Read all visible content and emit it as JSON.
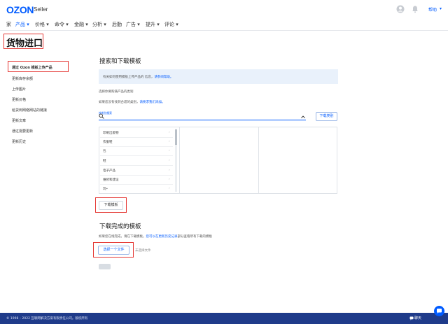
{
  "header": {
    "logo": "OZON",
    "logo_sub": "Seller",
    "help_label": "帮助",
    "help_caret": "▾"
  },
  "nav": {
    "items": [
      {
        "label": "家"
      },
      {
        "label": "产品 ▾"
      },
      {
        "label": "价格 ▾"
      },
      {
        "label": "命令 ▾"
      },
      {
        "label": "金融 ▾"
      },
      {
        "label": "分析 ▾"
      },
      {
        "label": "后勤"
      },
      {
        "label": "广告 ▾"
      },
      {
        "label": "提升 ▾"
      },
      {
        "label": "评论 ▾"
      }
    ]
  },
  "page_title": "货物进口",
  "sidebar": {
    "items": [
      {
        "label": "通过 Ozon 模板上传产品"
      },
      {
        "label": "更新库存余额"
      },
      {
        "label": "上传图片"
      },
      {
        "label": "更新价格"
      },
      {
        "label": "给货到网络网站的链接"
      },
      {
        "label": "更新文章"
      },
      {
        "label": "通过需要更新"
      },
      {
        "label": "更新历史"
      }
    ]
  },
  "main": {
    "search_heading": "搜索和下载模板",
    "info_text": "有关如何使用模板上传产品的 信息，",
    "info_link": "请参阅帮助。",
    "choose_category": "选择你要购满产品的类别",
    "hint_text": "如果您没有找到合适的类别，",
    "hint_link": "请要求我们添加。",
    "search_label": "按类别搜索",
    "download_category_button": "下载类别",
    "categories": [
      {
        "label": "印刷出版物"
      },
      {
        "label": "衣服鞋"
      },
      {
        "label": "包"
      },
      {
        "label": "鞋"
      },
      {
        "label": "电子产品"
      },
      {
        "label": "维修和建设"
      },
      {
        "label": "玩•"
      }
    ],
    "download_template_button": "下载模板",
    "upload_heading": "下载完成的模板",
    "upload_hint": "如果您在线完成，请在下载模板。",
    "upload_link": "您可以在更新历史记录",
    "upload_hint_tail": "部分查看所有下载的模板",
    "choose_file_button": "选择一个文件",
    "no_file_text": "未选择文件"
  },
  "footer": {
    "copyright": "© 1998 – 2022 互联网解决方案有限责任公司。版权所有",
    "chat_label": "聊天"
  },
  "colors": {
    "accent": "#005bff",
    "highlight_frame": "#e53935",
    "footer_bg": "#1f3b8a"
  }
}
